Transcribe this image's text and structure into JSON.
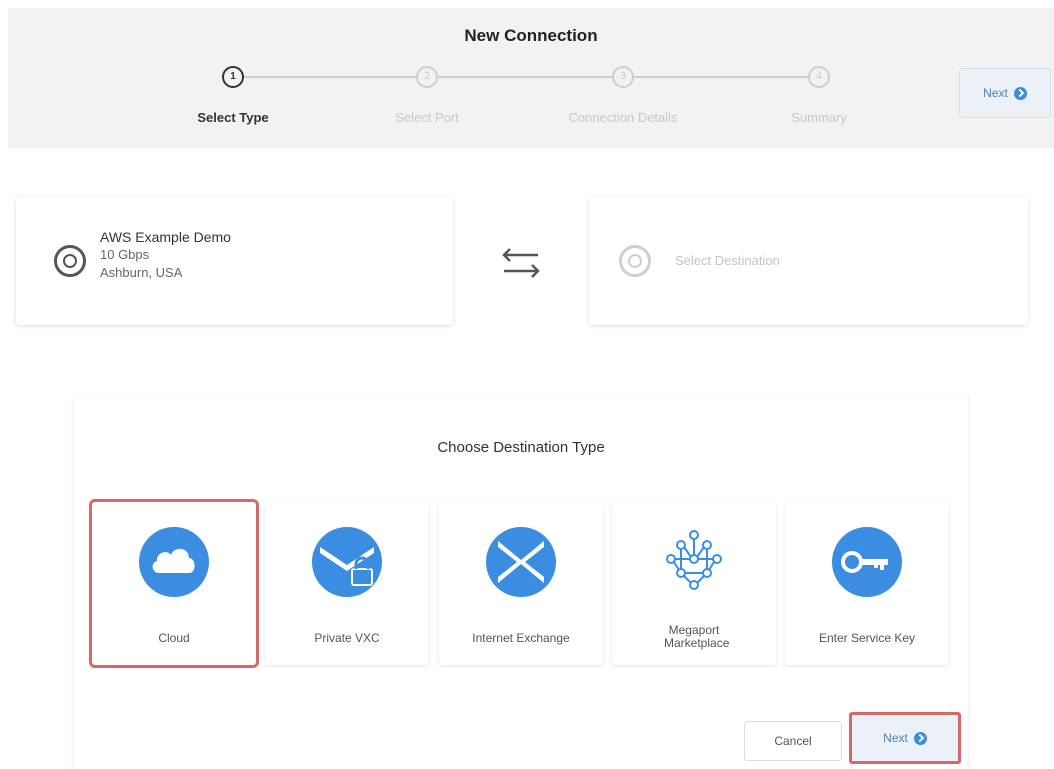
{
  "header": {
    "title": "New Connection",
    "next_label": "Next",
    "steps": [
      {
        "number": "1",
        "label": "Select Type"
      },
      {
        "number": "2",
        "label": "Select Port"
      },
      {
        "number": "3",
        "label": "Connection Details"
      },
      {
        "number": "4",
        "label": "Summary"
      }
    ]
  },
  "source": {
    "name": "AWS Example Demo",
    "speed": "10 Gbps",
    "location": "Ashburn, USA"
  },
  "destination": {
    "placeholder": "Select Destination"
  },
  "panel": {
    "title": "Choose Destination Type",
    "types": [
      {
        "label": "Cloud",
        "icon": "cloud-icon"
      },
      {
        "label": "Private VXC",
        "icon": "private-vxc-icon"
      },
      {
        "label": "Internet Exchange",
        "icon": "internet-exchange-icon"
      },
      {
        "label": "Megaport Marketplace",
        "icon": "network-icon"
      },
      {
        "label": "Enter Service Key",
        "icon": "key-icon"
      }
    ],
    "cancel_label": "Cancel",
    "next_label": "Next"
  },
  "colors": {
    "accent": "#3a8de0",
    "highlight": "#d66868",
    "header_bg": "#f2f2f2"
  }
}
